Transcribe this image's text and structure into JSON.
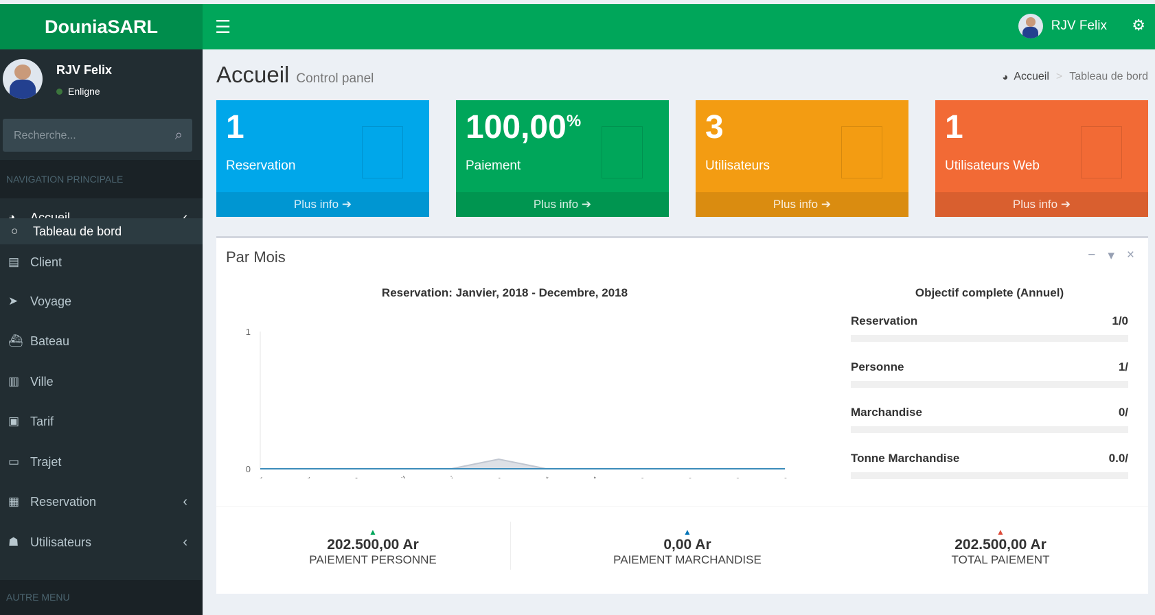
{
  "app": {
    "brand": "DouniaSARL"
  },
  "header": {
    "toggle_icon": "☰",
    "user_name": "RJV  Felix",
    "settings_icon": "⚙"
  },
  "sidebar": {
    "user": {
      "name": "RJV  Felix",
      "status": "Enligne"
    },
    "search": {
      "placeholder": "Recherche..."
    },
    "section_main": "NAVIGATION PRINCIPALE",
    "section_other": "AUTRE MENU",
    "items": [
      {
        "label": "Accueil",
        "icon": "dashboard-icon",
        "glyph": "◕"
      },
      {
        "label": "Tableau de bord",
        "icon": "circle-icon",
        "glyph": "○"
      },
      {
        "label": "Client",
        "icon": "file-icon",
        "glyph": "▤"
      },
      {
        "label": "Voyage",
        "icon": "plane-icon",
        "glyph": "➤"
      },
      {
        "label": "Bateau",
        "icon": "ship-icon",
        "glyph": "⛴"
      },
      {
        "label": "Ville",
        "icon": "map-icon",
        "glyph": "▥"
      },
      {
        "label": "Tarif",
        "icon": "money-icon",
        "glyph": "▣"
      },
      {
        "label": "Trajet",
        "icon": "bus-icon",
        "glyph": "▭"
      },
      {
        "label": "Reservation",
        "icon": "book-icon",
        "glyph": "▦"
      },
      {
        "label": "Utilisateurs",
        "icon": "users-icon",
        "glyph": "☗"
      }
    ]
  },
  "page": {
    "title": "Accueil",
    "subtitle": "Control panel",
    "breadcrumb": [
      "Accueil",
      "Tableau de bord"
    ]
  },
  "stats": [
    {
      "value": "1",
      "label": "Reservation",
      "more": "Plus info",
      "color": "#00a7ea"
    },
    {
      "value": "100,00",
      "suffix": "%",
      "label": "Paiement",
      "more": "Plus info",
      "color": "#00a65a"
    },
    {
      "value": "3",
      "label": "Utilisateurs",
      "more": "Plus info",
      "color": "#f39c12"
    },
    {
      "value": "1",
      "label": "Utilisateurs Web",
      "more": "Plus info",
      "color": "#f26a35"
    }
  ],
  "panel": {
    "title": "Par Mois"
  },
  "chart_data": {
    "type": "area",
    "title": "Reservation: Janvier, 2018 - Decembre, 2018",
    "categories": [
      "Janvier",
      "Fevrier",
      "Mars",
      "Avril",
      "Mai",
      "Juin",
      "Juillet",
      "Aout",
      "Septembre",
      "Octobre",
      "Novembre",
      "Decembre"
    ],
    "series": [
      {
        "values": [
          0,
          0,
          0,
          0,
          0,
          0,
          0,
          0,
          0,
          0,
          0,
          0
        ],
        "color": "#3b8bba"
      },
      {
        "values": [
          0,
          0,
          0,
          0,
          0,
          0.07,
          0,
          0,
          0,
          0,
          0,
          0
        ],
        "color": "#c1c7d1"
      }
    ],
    "ylim": [
      0,
      1
    ],
    "yticks": [
      "0",
      "1"
    ]
  },
  "goals": {
    "title": "Objectif complete (Annuel)",
    "items": [
      {
        "label": "Reservation",
        "value": "1/0"
      },
      {
        "label": "Personne",
        "value": "1/"
      },
      {
        "label": "Marchandise",
        "value": "0/"
      },
      {
        "label": "Tonne Marchandise",
        "value": "0.0/"
      }
    ]
  },
  "totals": [
    {
      "amount": "202.500,00 Ar",
      "label": "PAIEMENT PERSONNE",
      "caret_color": "#00a65a"
    },
    {
      "amount": "0,00 Ar",
      "label": "PAIEMENT MARCHANDISE",
      "caret_color": "#0073b7"
    },
    {
      "amount": "202.500,00 Ar",
      "label": "TOTAL PAIEMENT",
      "caret_color": "#dd4b39"
    }
  ]
}
